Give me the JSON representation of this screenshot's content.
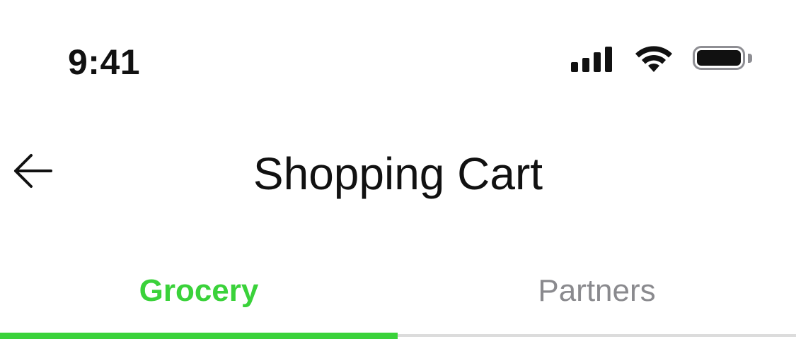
{
  "status_bar": {
    "time": "9:41",
    "icons": [
      "signal-icon",
      "wifi-icon",
      "battery-icon"
    ]
  },
  "header": {
    "back_icon": "arrow-left-icon",
    "title": "Shopping Cart"
  },
  "tabs": [
    {
      "label": "Grocery",
      "active": true
    },
    {
      "label": "Partners",
      "active": false
    }
  ],
  "colors": {
    "accent": "#3AD23A",
    "inactive_tab_text": "#8A8A8E",
    "text": "#111111",
    "divider": "#DCDCDC"
  }
}
